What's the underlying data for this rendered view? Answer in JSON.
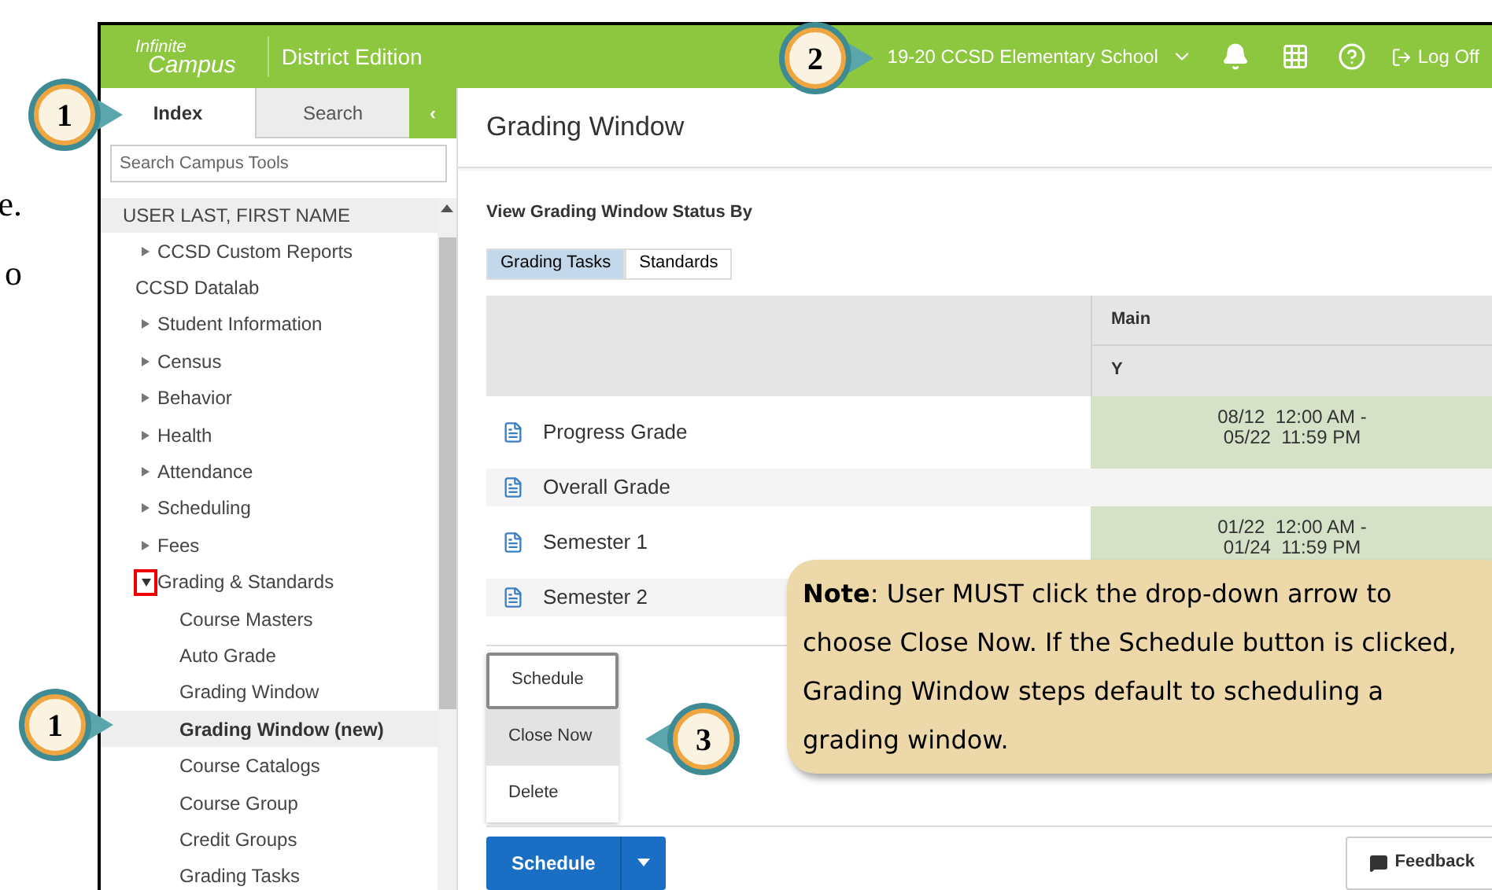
{
  "doc_fragments": [
    "e.",
    "o"
  ],
  "header": {
    "logo_line1": "Infinite",
    "logo_line2": "Campus",
    "edition": "District Edition",
    "school": "19-20 CCSD Elementary School",
    "logoff": "Log Off"
  },
  "sidebar": {
    "tabs": [
      {
        "label": "Index",
        "selected": true
      },
      {
        "label": "Search",
        "selected": false
      }
    ],
    "collapse": "‹",
    "search": {
      "placeholder": "Search Campus Tools"
    },
    "user": "USER LAST, FIRST NAME",
    "items": [
      {
        "label": "CCSD Custom Reports",
        "kind": "toggle",
        "expanded": false,
        "selected": false
      },
      {
        "label": "CCSD Datalab",
        "kind": "label",
        "selected": false
      },
      {
        "label": "Student Information",
        "kind": "toggle",
        "expanded": false,
        "selected": false
      },
      {
        "label": "Census",
        "kind": "toggle",
        "expanded": false,
        "selected": false
      },
      {
        "label": "Behavior",
        "kind": "toggle",
        "expanded": false,
        "selected": false
      },
      {
        "label": "Health",
        "kind": "toggle",
        "expanded": false,
        "selected": false
      },
      {
        "label": "Attendance",
        "kind": "toggle",
        "expanded": false,
        "selected": false
      },
      {
        "label": "Scheduling",
        "kind": "toggle",
        "expanded": false,
        "selected": false
      },
      {
        "label": "Fees",
        "kind": "toggle",
        "expanded": false,
        "selected": false
      },
      {
        "label": "Grading & Standards",
        "kind": "toggle",
        "expanded": true,
        "selected": false,
        "marked": true,
        "children": [
          {
            "label": "Course Masters",
            "selected": false
          },
          {
            "label": "Auto Grade",
            "selected": false
          },
          {
            "label": "Grading Window",
            "selected": false
          },
          {
            "label": "Grading Window (new)",
            "selected": true
          },
          {
            "label": "Course Catalogs",
            "selected": false
          },
          {
            "label": "Course Group",
            "selected": false
          },
          {
            "label": "Credit Groups",
            "selected": false
          },
          {
            "label": "Grading Tasks",
            "selected": false
          }
        ]
      }
    ]
  },
  "main": {
    "title": "Grading Window",
    "view_by": "View Grading Window Status By",
    "toggles": [
      {
        "label": "Grading Tasks",
        "selected": true
      },
      {
        "label": "Standards",
        "selected": false
      }
    ],
    "table": {
      "header_top": "Main",
      "header_sub": "Y",
      "rows": [
        {
          "name": "Progress Grade",
          "window": [
            "08/12  12:00 AM -",
            "05/22  11:59 PM"
          ]
        },
        {
          "name": "Overall Grade"
        },
        {
          "name": "Semester 1",
          "window": [
            "01/22  12:00 AM -",
            "01/24  11:59 PM"
          ]
        },
        {
          "name": "Semester 2"
        }
      ]
    },
    "menu": [
      {
        "label": "Schedule",
        "focused": true,
        "selected": false
      },
      {
        "label": "Close Now",
        "focused": false,
        "selected": true
      },
      {
        "label": "Delete",
        "focused": false,
        "selected": false
      }
    ],
    "schedule_button": "Schedule",
    "feedback": "Feedback"
  },
  "callouts": [
    "1",
    "2",
    "1",
    "3"
  ],
  "note": "**Note**:  User MUST click the drop-down arrow to choose Close Now. If the Schedule button is clicked, Grading Window steps default to scheduling a grading window."
}
